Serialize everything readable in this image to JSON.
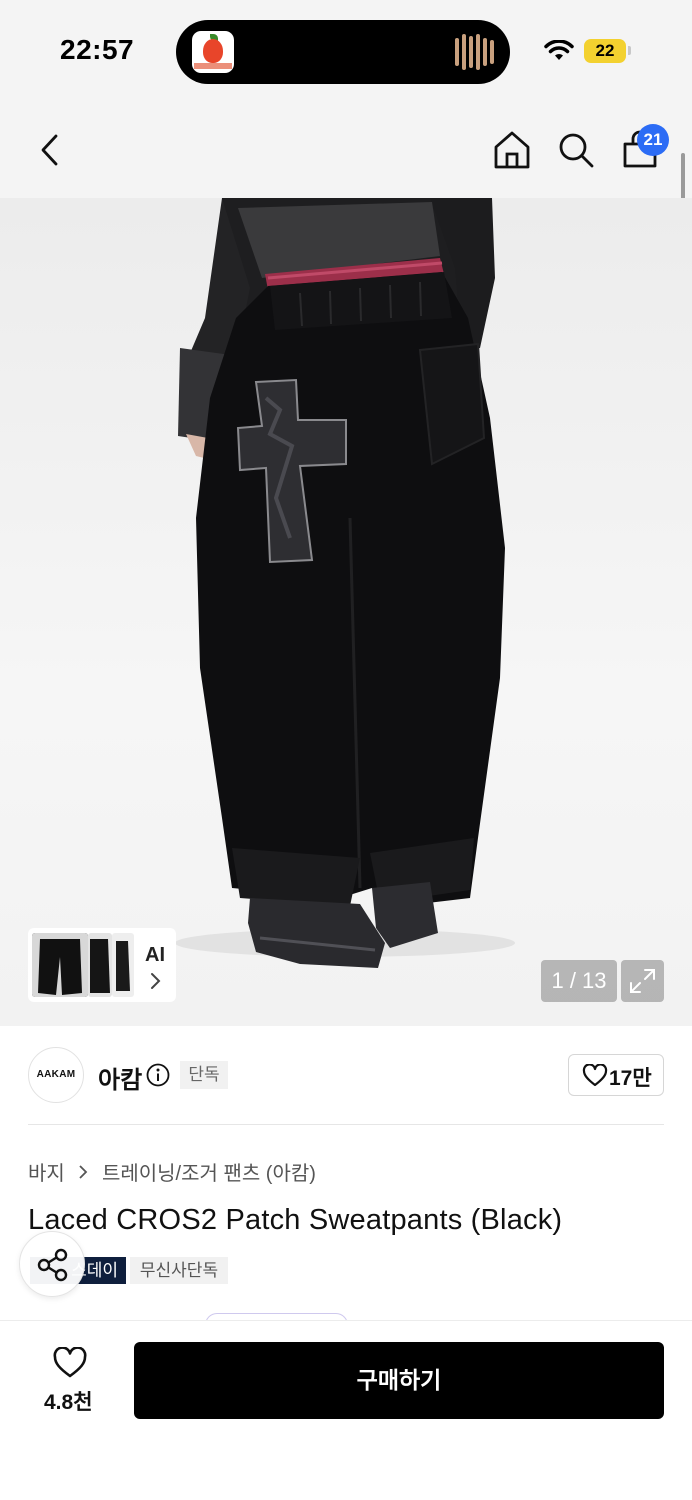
{
  "status_bar": {
    "time": "22:57",
    "battery": "22",
    "icons": [
      "wifi-icon",
      "battery-icon"
    ]
  },
  "header": {
    "icons": [
      "back-arrow-icon",
      "home-icon",
      "search-icon",
      "cart-icon"
    ],
    "cart_count": "21"
  },
  "gallery": {
    "ai_label": "AI",
    "counter": "1 / 13"
  },
  "brand": {
    "logo_text": "AAKAM",
    "name": "아캄",
    "exclusive_badge": "단독",
    "likes": "17만"
  },
  "product": {
    "breadcrumb": [
      "바지",
      "트레이닝/조거 팬츠 (아캄)"
    ],
    "title": "Laced CROS2 Patch Sweatpants (Black)",
    "tags": [
      "스데이",
      "무신사단독"
    ]
  },
  "bottom_bar": {
    "wish_count": "4.8천",
    "buy_label": "구매하기"
  },
  "colors": {
    "accent_blue": "#2c6cf5",
    "tag_navy": "#0f1f3d",
    "battery_yellow": "#f3d12f"
  }
}
